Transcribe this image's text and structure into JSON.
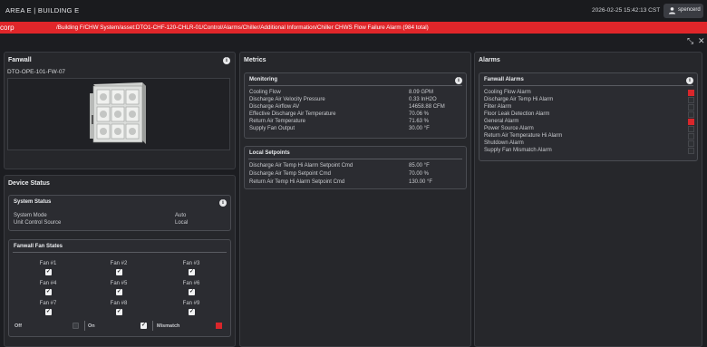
{
  "header": {
    "location": "AREA E | BUILDING E",
    "datetime": "2026-02-25 15:42:13 CST",
    "user": "spencerd"
  },
  "alarm_banner": {
    "prefix": "corp",
    "path": "/Building F/CHW System/asset:DTO1-CHF-120-CHLR-01/Control/Alarms/Chiller/Additional Information/Chiller CHWS Flow Failure Alarm (984 total)"
  },
  "fanwall": {
    "title": "Fanwall",
    "device_id": "DTO-OPE-101-FW-07"
  },
  "device_status": {
    "title": "Device Status",
    "system_status": {
      "title": "System Status",
      "rows": [
        {
          "label": "System Mode",
          "value": "Auto"
        },
        {
          "label": "Unit Control Source",
          "value": "Local"
        }
      ]
    },
    "fan_states": {
      "title": "Fanwall Fan States",
      "fans": [
        {
          "label": "Fan #1",
          "checked": true
        },
        {
          "label": "Fan #2",
          "checked": true
        },
        {
          "label": "Fan #3",
          "checked": true
        },
        {
          "label": "Fan #4",
          "checked": true
        },
        {
          "label": "Fan #5",
          "checked": true
        },
        {
          "label": "Fan #6",
          "checked": true
        },
        {
          "label": "Fan #7",
          "checked": true
        },
        {
          "label": "Fan #8",
          "checked": true
        },
        {
          "label": "Fan #9",
          "checked": true
        }
      ],
      "legend": {
        "off": "Off",
        "on": "On",
        "mismatch": "Mismatch"
      }
    }
  },
  "metrics": {
    "title": "Metrics",
    "monitoring": {
      "title": "Monitoring",
      "rows": [
        {
          "label": "Cooling Flow",
          "value": "8.09 GPM"
        },
        {
          "label": "Discharge Air Velocity Pressure",
          "value": "0.33 InH2O"
        },
        {
          "label": "Discharge Airflow AV",
          "value": "14658.88 CFM"
        },
        {
          "label": "Effective Discharge Air Temperature",
          "value": "70.06 %"
        },
        {
          "label": "Return Air Temperature",
          "value": "71.63 %"
        },
        {
          "label": "Supply Fan Output",
          "value": "30.00 °F"
        }
      ]
    },
    "local_setpoints": {
      "title": "Local Setpoints",
      "rows": [
        {
          "label": "Discharge Air Temp Hi Alarm Setpoint Cmd",
          "value": "85.00 °F"
        },
        {
          "label": "Discharge Air Temp Setpoint Cmd",
          "value": "70.00 %"
        },
        {
          "label": "Return Air Temp Hi Alarm Setpoint Cmd",
          "value": "130.00 °F"
        }
      ]
    }
  },
  "alarms": {
    "title": "Alarms",
    "fanwall_alarms": {
      "title": "Fanwall Alarms",
      "items": [
        {
          "label": "Cooling Flow Alarm",
          "active": true
        },
        {
          "label": "Discharge Air Temp Hi Alarm",
          "active": false
        },
        {
          "label": "Filter Alarm",
          "active": false
        },
        {
          "label": "Floor Leak Detection Alarm",
          "active": false
        },
        {
          "label": "General Alarm",
          "active": true
        },
        {
          "label": "Power Source Alarm",
          "active": false
        },
        {
          "label": "Return Air Temperature Hi Alarm",
          "active": false
        },
        {
          "label": "Shutdown Alarm",
          "active": false
        },
        {
          "label": "Supply Fan Mismatch Alarm",
          "active": false
        }
      ]
    }
  },
  "colors": {
    "alarm_red": "#e0262a",
    "panel": "#26272b",
    "background": "#1c1d21"
  }
}
